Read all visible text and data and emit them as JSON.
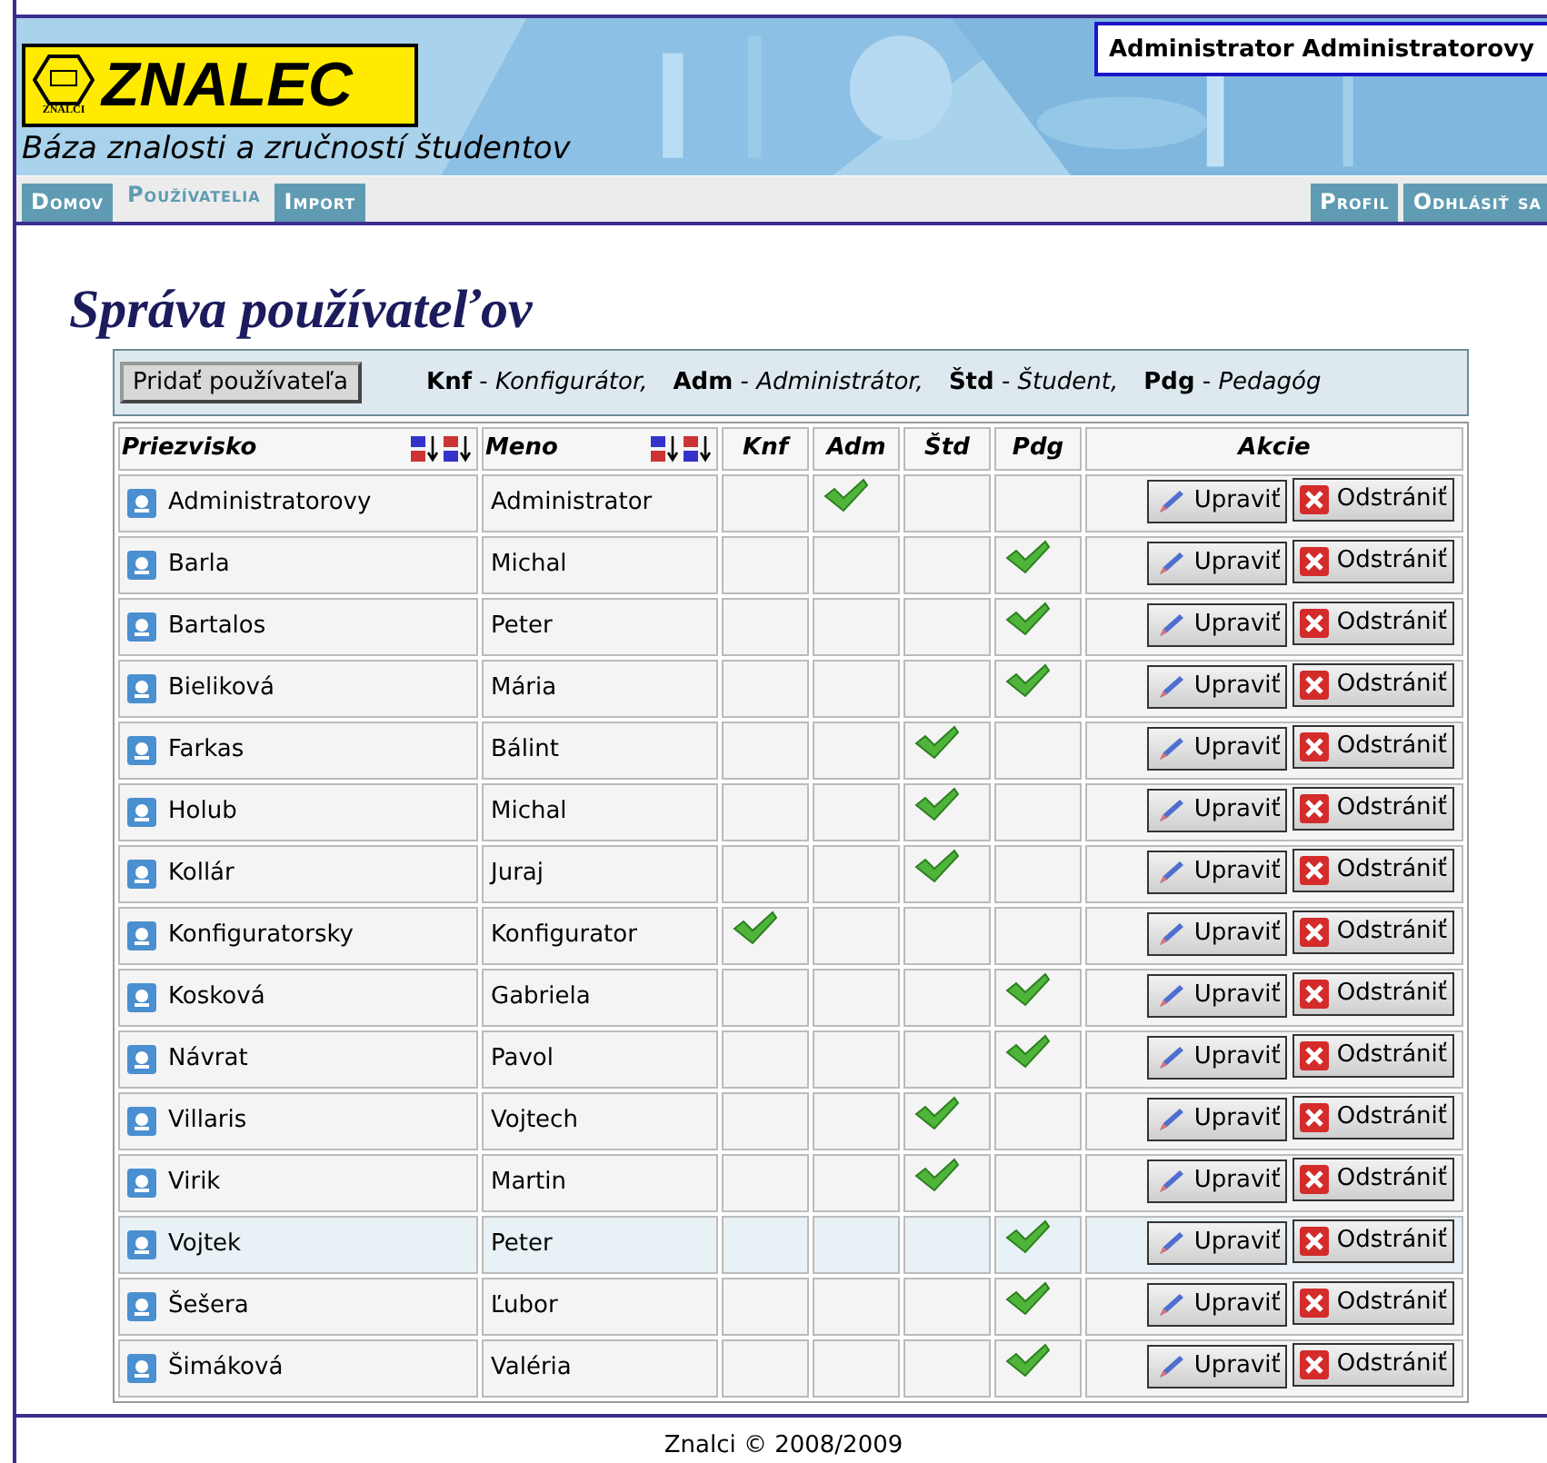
{
  "logo": {
    "title": "ZNALEC",
    "badge": "ZNALCI",
    "subtitle": "Báza znalosti a zručností študentov"
  },
  "user_box": {
    "text": "Administrator Administratorovy"
  },
  "nav_left": [
    {
      "label": "Domov",
      "selected": false
    },
    {
      "label": "Používatelia",
      "selected": true
    },
    {
      "label": "Import",
      "selected": false
    }
  ],
  "nav_right": [
    {
      "label": "Profil"
    },
    {
      "label": "Odhlásiť sa"
    }
  ],
  "page_title": "Správa používateľov",
  "add_button": "Pridať používateľa",
  "legend": [
    "**Knf** - *Konfigurátor,*",
    "**Adm** - *Administrátor,*",
    "**Štd** - *Študent,*",
    "**Pdg** - *Pedagóg*"
  ],
  "table": {
    "columns": [
      {
        "label": "Priezvisko",
        "sortable": true
      },
      {
        "label": "Meno",
        "sortable": true
      },
      {
        "label": "Knf",
        "sortable": false
      },
      {
        "label": "Adm",
        "sortable": false
      },
      {
        "label": "Štd",
        "sortable": false
      },
      {
        "label": "Pdg",
        "sortable": false
      },
      {
        "label": "Akcie",
        "sortable": false
      }
    ],
    "rows": [
      {
        "surname": "Administratorovy",
        "name": "Administrator",
        "knf": false,
        "adm": true,
        "std": false,
        "pdg": false,
        "highlighted": false,
        "edit": "Upraviť",
        "delete": "Odstrániť"
      },
      {
        "surname": "Barla",
        "name": "Michal",
        "knf": false,
        "adm": false,
        "std": false,
        "pdg": true,
        "highlighted": false,
        "edit": "Upraviť",
        "delete": "Odstrániť"
      },
      {
        "surname": "Bartalos",
        "name": "Peter",
        "knf": false,
        "adm": false,
        "std": false,
        "pdg": true,
        "highlighted": false,
        "edit": "Upraviť",
        "delete": "Odstrániť"
      },
      {
        "surname": "Bieliková",
        "name": "Mária",
        "knf": false,
        "adm": false,
        "std": false,
        "pdg": true,
        "highlighted": false,
        "edit": "Upraviť",
        "delete": "Odstrániť"
      },
      {
        "surname": "Farkas",
        "name": "Bálint",
        "knf": false,
        "adm": false,
        "std": true,
        "pdg": false,
        "highlighted": false,
        "edit": "Upraviť",
        "delete": "Odstrániť"
      },
      {
        "surname": "Holub",
        "name": "Michal",
        "knf": false,
        "adm": false,
        "std": true,
        "pdg": false,
        "highlighted": false,
        "edit": "Upraviť",
        "delete": "Odstrániť"
      },
      {
        "surname": "Kollár",
        "name": "Juraj",
        "knf": false,
        "adm": false,
        "std": true,
        "pdg": false,
        "highlighted": false,
        "edit": "Upraviť",
        "delete": "Odstrániť"
      },
      {
        "surname": "Konfiguratorsky",
        "name": "Konfigurator",
        "knf": true,
        "adm": false,
        "std": false,
        "pdg": false,
        "highlighted": false,
        "edit": "Upraviť",
        "delete": "Odstrániť"
      },
      {
        "surname": "Kosková",
        "name": "Gabriela",
        "knf": false,
        "adm": false,
        "std": false,
        "pdg": true,
        "highlighted": false,
        "edit": "Upraviť",
        "delete": "Odstrániť"
      },
      {
        "surname": "Návrat",
        "name": "Pavol",
        "knf": false,
        "adm": false,
        "std": false,
        "pdg": true,
        "highlighted": false,
        "edit": "Upraviť",
        "delete": "Odstrániť"
      },
      {
        "surname": "Villaris",
        "name": "Vojtech",
        "knf": false,
        "adm": false,
        "std": true,
        "pdg": false,
        "highlighted": false,
        "edit": "Upraviť",
        "delete": "Odstrániť"
      },
      {
        "surname": "Virik",
        "name": "Martin",
        "knf": false,
        "adm": false,
        "std": true,
        "pdg": false,
        "highlighted": false,
        "edit": "Upraviť",
        "delete": "Odstrániť"
      },
      {
        "surname": "Vojtek",
        "name": "Peter",
        "knf": false,
        "adm": false,
        "std": false,
        "pdg": true,
        "highlighted": true,
        "edit": "Upraviť",
        "delete": "Odstrániť"
      },
      {
        "surname": "Šešera",
        "name": "Ľubor",
        "knf": false,
        "adm": false,
        "std": false,
        "pdg": true,
        "highlighted": false,
        "edit": "Upraviť",
        "delete": "Odstrániť"
      },
      {
        "surname": "Šimáková",
        "name": "Valéria",
        "knf": false,
        "adm": false,
        "std": false,
        "pdg": true,
        "highlighted": false,
        "edit": "Upraviť",
        "delete": "Odstrániť"
      }
    ]
  },
  "footer": "Znalci © 2008/2009"
}
